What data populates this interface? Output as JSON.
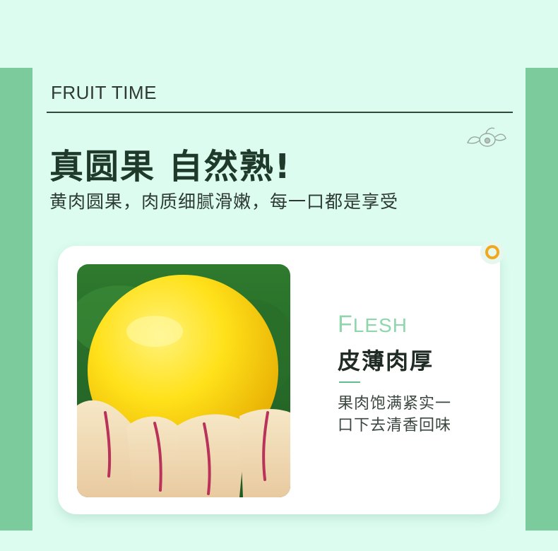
{
  "header": {
    "eyebrow": "FRUIT TIME",
    "headline": "真圆果 自然熟!",
    "subline": "黄肉圆果，肉质细腻滑嫩，每一口都是享受"
  },
  "card": {
    "en_first": "F",
    "en_rest": "LESH",
    "title": "皮薄肉厚",
    "desc_line1": "果肉饱满紧实一",
    "desc_line2": "口下去清香回味"
  },
  "colors": {
    "background_light": "#dbfcef",
    "background_side": "#7ccb9c",
    "headline": "#1f3a2a",
    "accent_green": "#8fd6ad",
    "ring_orange": "#f2a81c"
  },
  "icons": [
    "leaf-fruit-icon",
    "ring-icon"
  ]
}
